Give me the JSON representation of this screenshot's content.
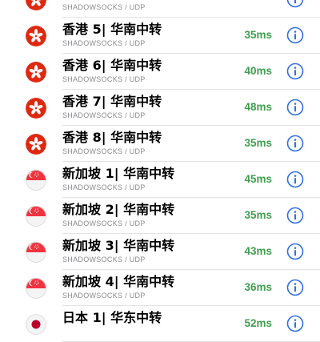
{
  "colors": {
    "latency_green": "#3f9e4f",
    "info_blue": "#2f6fe0",
    "hk_red": "#de2910",
    "sg_red": "#ef3340",
    "jp_red": "#bc002d"
  },
  "servers": [
    {
      "flag": "hong-kong-flag",
      "name": "",
      "protocol": "SHADOWSOCKS / UDP",
      "latency": ""
    },
    {
      "flag": "hong-kong-flag",
      "name": "香港 5| 华南中转",
      "protocol": "SHADOWSOCKS / UDP",
      "latency": "35ms"
    },
    {
      "flag": "hong-kong-flag",
      "name": "香港 6| 华南中转",
      "protocol": "SHADOWSOCKS / UDP",
      "latency": "40ms"
    },
    {
      "flag": "hong-kong-flag",
      "name": "香港 7| 华南中转",
      "protocol": "SHADOWSOCKS / UDP",
      "latency": "48ms"
    },
    {
      "flag": "hong-kong-flag",
      "name": "香港 8| 华南中转",
      "protocol": "SHADOWSOCKS / UDP",
      "latency": "35ms"
    },
    {
      "flag": "singapore-flag",
      "name": "新加坡 1| 华南中转",
      "protocol": "SHADOWSOCKS / UDP",
      "latency": "45ms"
    },
    {
      "flag": "singapore-flag",
      "name": "新加坡 2| 华南中转",
      "protocol": "SHADOWSOCKS / UDP",
      "latency": "35ms"
    },
    {
      "flag": "singapore-flag",
      "name": "新加坡 3| 华南中转",
      "protocol": "SHADOWSOCKS / UDP",
      "latency": "43ms"
    },
    {
      "flag": "singapore-flag",
      "name": "新加坡 4| 华南中转",
      "protocol": "SHADOWSOCKS / UDP",
      "latency": "36ms"
    },
    {
      "flag": "japan-flag",
      "name": "日本 1| 华东中转",
      "protocol": "",
      "latency": "52ms"
    }
  ]
}
